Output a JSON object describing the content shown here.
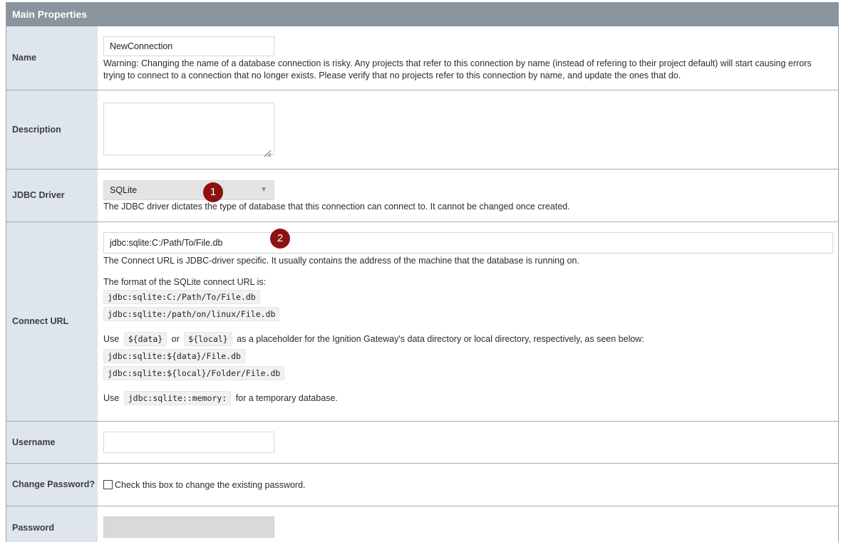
{
  "header": {
    "title": "Main Properties"
  },
  "name": {
    "label": "Name",
    "value": "NewConnection",
    "warning": "Warning: Changing the name of a database connection is risky. Any projects that refer to this connection by name (instead of refering to their project default) will start causing errors trying to connect to a connection that no longer exists. Please verify that no projects refer to this connection by name, and update the ones that do."
  },
  "description": {
    "label": "Description",
    "value": ""
  },
  "driver": {
    "label": "JDBC Driver",
    "value": "SQLite",
    "help": "The JDBC driver dictates the type of database that this connection can connect to. It cannot be changed once created.",
    "badge": "1"
  },
  "connect_url": {
    "label": "Connect URL",
    "value": "jdbc:sqlite:C:/Path/To/File.db",
    "badge": "2",
    "help1": "The Connect URL is JDBC-driver specific. It usually contains the address of the machine that the database is running on.",
    "format_intro": "The format of the SQLite connect URL is:",
    "format_examples": [
      "jdbc:sqlite:C:/Path/To/File.db",
      "jdbc:sqlite:/path/on/linux/File.db"
    ],
    "use_word": "Use",
    "or_word": "or",
    "placeholder_data": "${data}",
    "placeholder_local": "${local}",
    "placeholder_text": "as a placeholder for the Ignition Gateway's data directory or local directory, respectively, as seen below:",
    "placeholder_examples": [
      "jdbc:sqlite:${data}/File.db",
      "jdbc:sqlite:${local}/Folder/File.db"
    ],
    "memory_code": "jdbc:sqlite::memory:",
    "memory_text": "for a temporary database."
  },
  "username": {
    "label": "Username",
    "value": ""
  },
  "change_password": {
    "label": "Change Password?",
    "checkbox_text": "Check this box to change the existing password."
  },
  "password": {
    "label": "Password",
    "value": ""
  },
  "colors": {
    "header_bg": "#8a949e",
    "label_bg": "#dfe5ec",
    "badge_bg": "#8d1212"
  }
}
